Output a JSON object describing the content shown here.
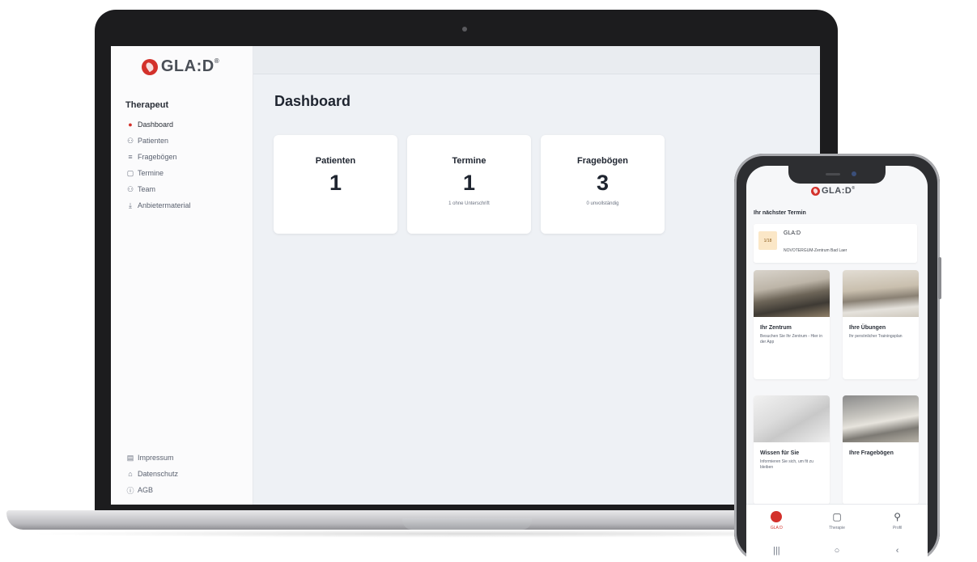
{
  "brand": {
    "name": "GLA:D",
    "trademark": "®",
    "accent": "#d3312b"
  },
  "desktop": {
    "sidebar": {
      "role": "Therapeut",
      "items": [
        {
          "label": "Dashboard",
          "icon": "glad-icon",
          "active": true
        },
        {
          "label": "Patienten",
          "icon": "users-icon"
        },
        {
          "label": "Fragebögen",
          "icon": "list-icon"
        },
        {
          "label": "Termine",
          "icon": "calendar-icon"
        },
        {
          "label": "Team",
          "icon": "users-icon"
        },
        {
          "label": "Anbietermaterial",
          "icon": "download-icon"
        }
      ],
      "footer": [
        {
          "label": "Impressum",
          "icon": "document-icon"
        },
        {
          "label": "Datenschutz",
          "icon": "lock-icon"
        },
        {
          "label": "AGB",
          "icon": "info-icon"
        }
      ]
    },
    "page_title": "Dashboard",
    "cards": [
      {
        "title": "Patienten",
        "value": "1",
        "sub": ""
      },
      {
        "title": "Termine",
        "value": "1",
        "sub": "1 ohne Unterschrift"
      },
      {
        "title": "Fragebögen",
        "value": "3",
        "sub": "0 unvollständig"
      }
    ]
  },
  "mobile": {
    "section_title": "Ihr nächster Termin",
    "appointment": {
      "date": "1/18",
      "title": "GLA:D",
      "location": "NOVOTERGUM-Zentrum Bad Laer"
    },
    "tiles": [
      {
        "title": "Ihr Zentrum",
        "desc": "Besuchen Sie Ihr Zentrum - Hier in der App"
      },
      {
        "title": "Ihre Übungen",
        "desc": "Ihr persönlicher Trainingsplan"
      },
      {
        "title": "Wissen für Sie",
        "desc": "Informieren Sie sich, um fit zu bleiben"
      },
      {
        "title": "Ihre Fragebögen",
        "desc": ""
      }
    ],
    "tabs": [
      {
        "label": "GLA:D",
        "icon": "glad-icon",
        "active": true
      },
      {
        "label": "Therapie",
        "icon": "calendar-icon"
      },
      {
        "label": "Profil",
        "icon": "user-icon"
      }
    ],
    "system_nav": [
      "|||",
      "○",
      "‹"
    ]
  }
}
